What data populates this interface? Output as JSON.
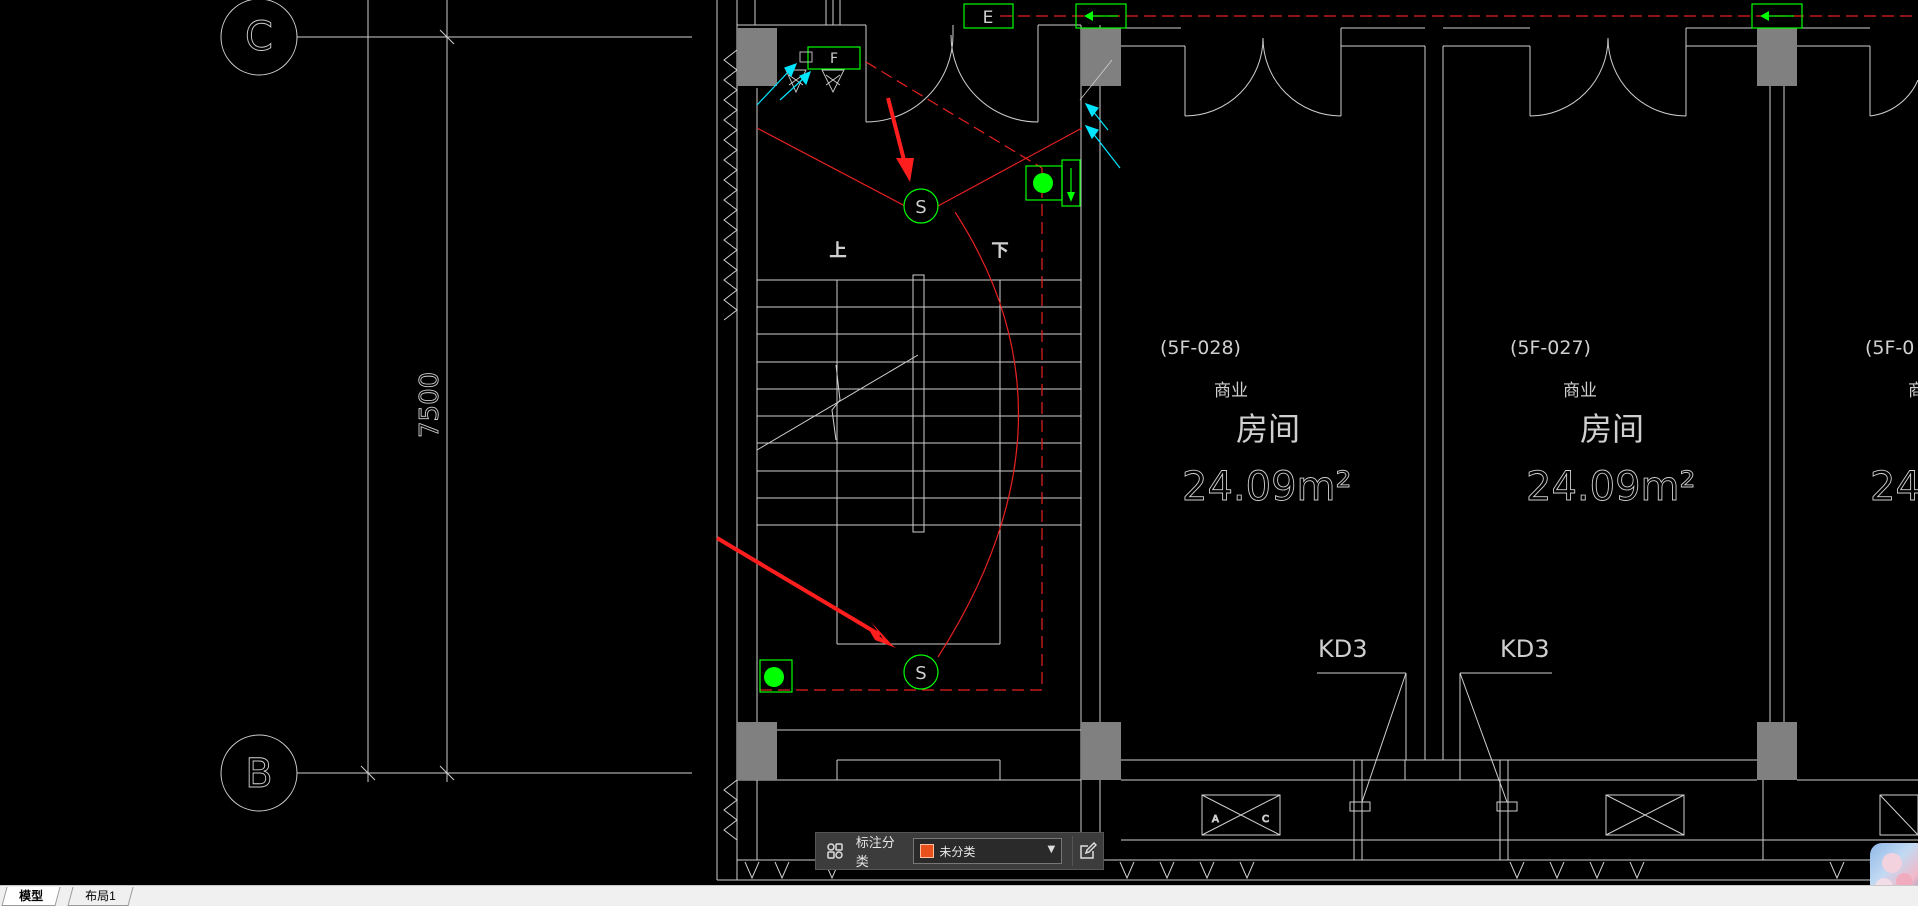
{
  "canvas": {
    "background": "#000000",
    "colors": {
      "line": "#cfcfcf",
      "red": "#e62020",
      "green": "#00ff00",
      "cyan": "#00e5ff",
      "column": "#808080"
    },
    "grid_labels": {
      "c": "C",
      "b": "B"
    },
    "dimension": "7500",
    "tags": {
      "e": "E",
      "f": "F"
    },
    "smoke_detector": "S",
    "stair": {
      "up": "上",
      "down": "下"
    },
    "rooms": [
      {
        "code": "(5F-028)",
        "use": "商业",
        "name": "房间",
        "area": "24.09m²"
      },
      {
        "code": "(5F-027)",
        "use": "商业",
        "name": "房间",
        "area": "24.09m²"
      },
      {
        "code": "(5F-0",
        "use": "商",
        "name": "",
        "area": "24."
      }
    ],
    "door_tags": [
      "KD3",
      "KD3"
    ],
    "arrow_markers": {
      "a": "A",
      "c": "C"
    }
  },
  "annotation_toolbar": {
    "grid_icon": "grid-icon",
    "label": "标注分类",
    "select": {
      "value": "未分类",
      "swatch_color": "#e8501c"
    },
    "edit_icon": "edit-icon"
  },
  "layout_tabs": [
    {
      "label": "模型",
      "active": true
    },
    {
      "label": "布局1",
      "active": false
    }
  ]
}
